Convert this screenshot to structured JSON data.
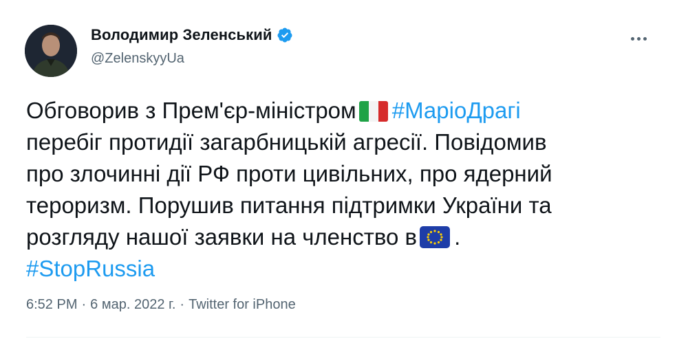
{
  "author": {
    "display_name": "Володимир Зеленський",
    "handle": "@ZelenskyyUa",
    "verified": true
  },
  "icons": {
    "avatar": "profile-photo",
    "verified": "verified-badge-icon",
    "more": "more-options-icon",
    "flag_italy": "italy-flag-emoji",
    "flag_eu": "eu-flag-emoji"
  },
  "tweet": {
    "l1_a": "Обговорив з Прем'єр-міністром",
    "l1_tag": "#МаріоДрагі",
    "l2": "перебіг протидії загарбницькій агресії. Повідомив",
    "l3": "про злочинні дії РФ проти цивільних, про ядерний",
    "l4": "тероризм. Порушив питання підтримки України та",
    "l5_a": "розгляду нашої заявки на членство в",
    "l5_b": ".",
    "l6_tag": "#StopRussia"
  },
  "meta": {
    "time": "6:52 PM",
    "separator": "·",
    "date": "6 мар. 2022 г.",
    "source": "Twitter for iPhone"
  },
  "colors": {
    "link": "#1d9bf0",
    "text": "#0f1419",
    "secondary": "#536471",
    "verified": "#1d9bf0"
  }
}
